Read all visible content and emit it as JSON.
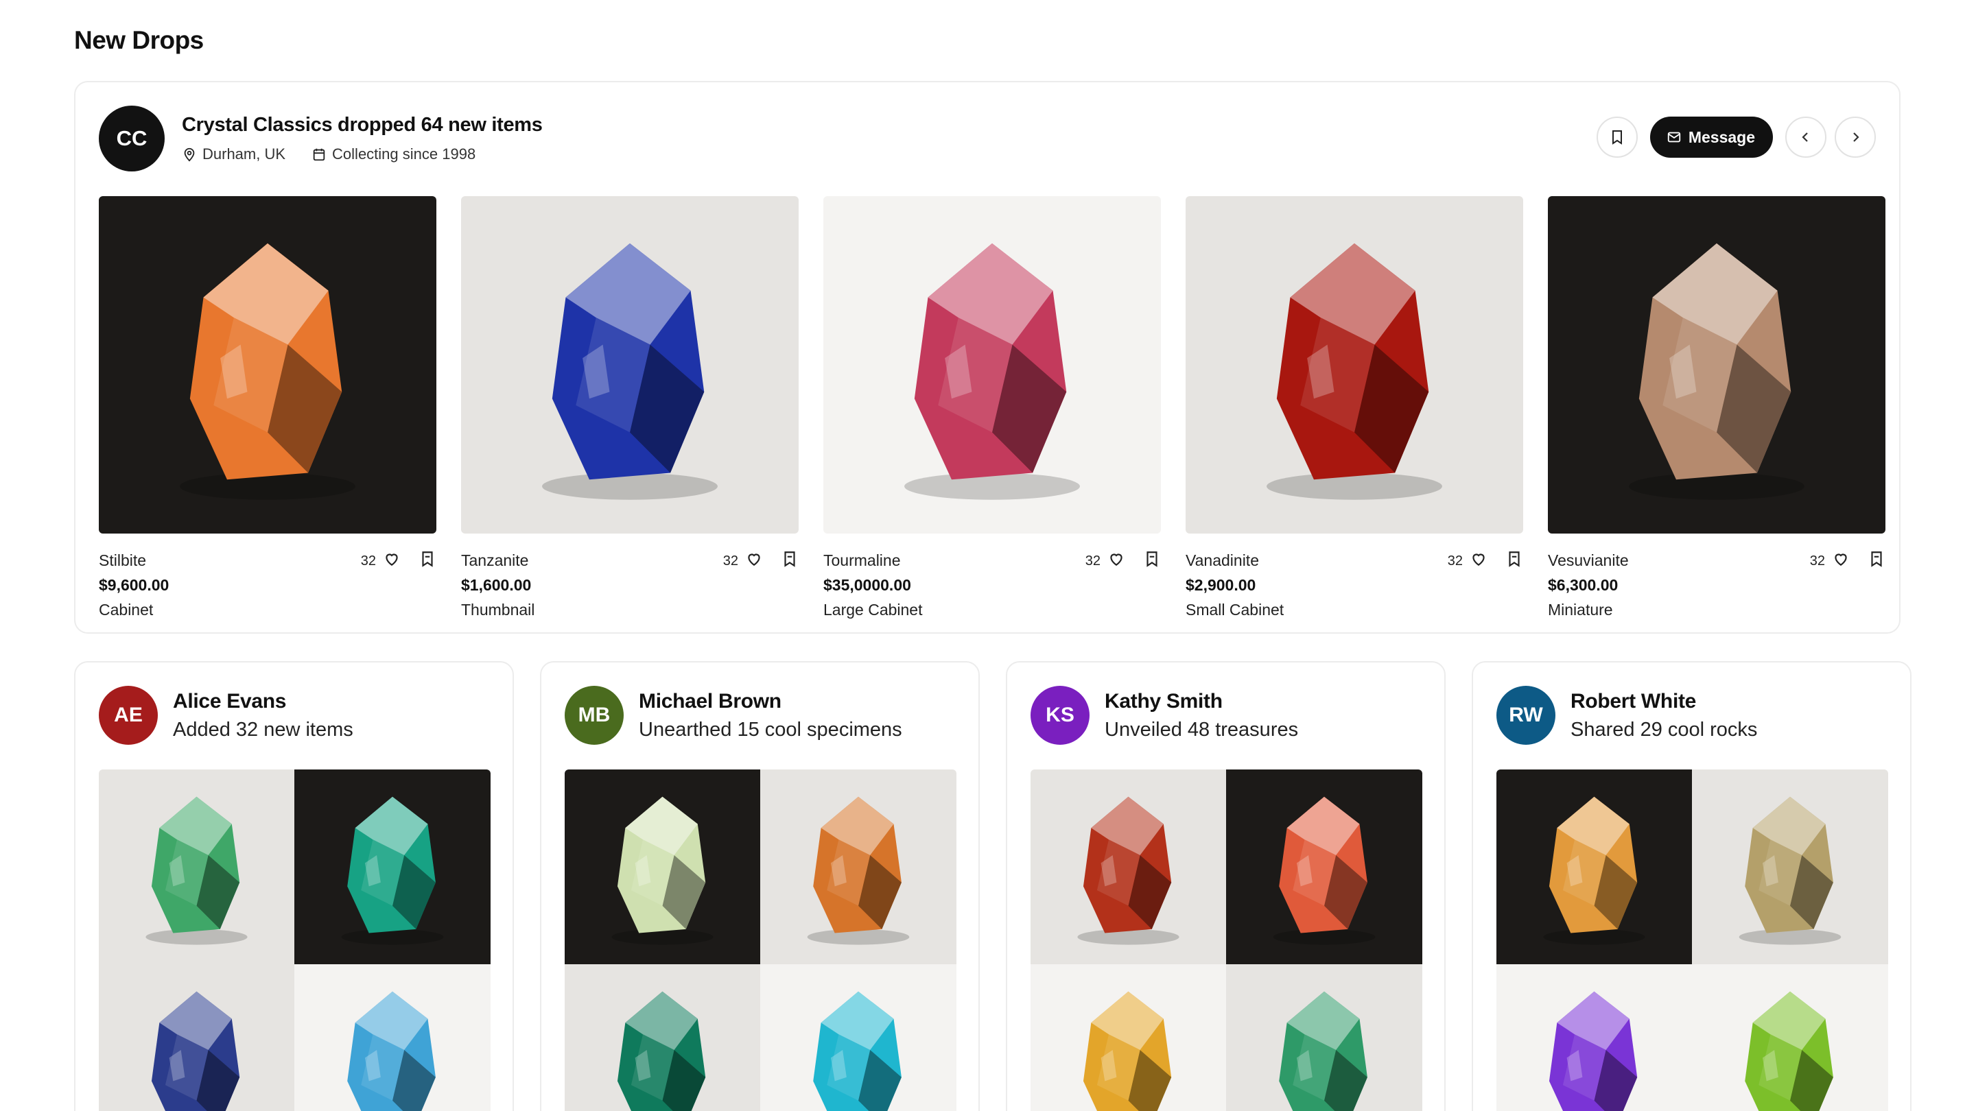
{
  "page": {
    "title": "New Drops"
  },
  "featured": {
    "avatar_initials": "CC",
    "avatar_color": "#121212",
    "title": "Crystal Classics dropped 64 new items",
    "location": "Durham, UK",
    "since": "Collecting since 1998",
    "message_label": "Message",
    "icons": {
      "location": "map-pin-icon",
      "since": "calendar-icon",
      "save": "bookmark-icon",
      "message": "mail-icon",
      "prev": "chevron-left-icon",
      "next": "chevron-right-icon"
    },
    "products": [
      {
        "name": "Stilbite",
        "price": "$9,600.00",
        "size": "Cabinet",
        "likes": "32",
        "bg": "dark",
        "color": "#e8772e"
      },
      {
        "name": "Tanzanite",
        "price": "$1,600.00",
        "size": "Thumbnail",
        "likes": "32",
        "bg": "light",
        "color": "#1e33a8"
      },
      {
        "name": "Tourmaline",
        "price": "$35,0000.00",
        "size": "Large Cabinet",
        "likes": "32",
        "bg": "white",
        "color": "#c33a5c"
      },
      {
        "name": "Vanadinite",
        "price": "$2,900.00",
        "size": "Small Cabinet",
        "likes": "32",
        "bg": "light",
        "color": "#a8170f"
      },
      {
        "name": "Vesuvianite",
        "price": "$6,300.00",
        "size": "Miniature",
        "likes": "32",
        "bg": "dark",
        "color": "#b58a6e"
      }
    ]
  },
  "collectors": [
    {
      "initials": "AE",
      "name": "Alice Evans",
      "subtitle": "Added 32 new items",
      "color": "#a51c1c",
      "tiles": [
        {
          "bg": "light",
          "color": "#3fa768"
        },
        {
          "bg": "dark",
          "color": "#17a284"
        },
        {
          "bg": "light",
          "color": "#2b3c8c"
        },
        {
          "bg": "white",
          "color": "#3fa3d6"
        }
      ]
    },
    {
      "initials": "MB",
      "name": "Michael Brown",
      "subtitle": "Unearthed 15 cool specimens",
      "color": "#4a6b1e",
      "tiles": [
        {
          "bg": "dark",
          "color": "#cfe0b0"
        },
        {
          "bg": "light",
          "color": "#d6742a"
        },
        {
          "bg": "light",
          "color": "#0f7a5c"
        },
        {
          "bg": "white",
          "color": "#1fb6cf"
        }
      ]
    },
    {
      "initials": "KS",
      "name": "Kathy Smith",
      "subtitle": "Unveiled 48 treasures",
      "color": "#7a1fbf",
      "tiles": [
        {
          "bg": "light",
          "color": "#b3311a"
        },
        {
          "bg": "dark",
          "color": "#e05a3a"
        },
        {
          "bg": "white",
          "color": "#e3a52a"
        },
        {
          "bg": "light",
          "color": "#2e9a68"
        }
      ]
    },
    {
      "initials": "RW",
      "name": "Robert White",
      "subtitle": "Shared 29 cool rocks",
      "color": "#0d5a86",
      "tiles": [
        {
          "bg": "dark",
          "color": "#e29a3c"
        },
        {
          "bg": "light",
          "color": "#b4a06a"
        },
        {
          "bg": "white",
          "color": "#7a34d6"
        },
        {
          "bg": "white",
          "color": "#7cbf2a"
        }
      ]
    }
  ]
}
